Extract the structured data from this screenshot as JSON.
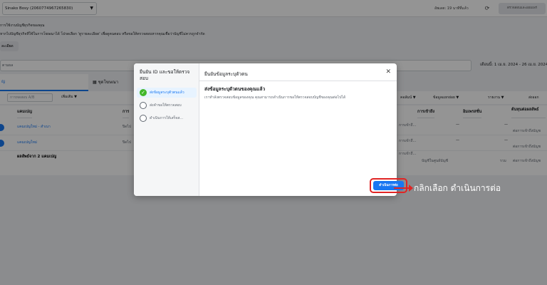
{
  "topbar": {
    "account_select": "Sinako Bosy (2060774967265830)",
    "updated_text": "อัพเดต: 19 นาทีที่แล้ว",
    "review_button": "ตรวจสอบและเผยแพร่"
  },
  "notice": {
    "line1": "การใช้งานบัญชีธุรกิจของคุณ",
    "line2": "หากไปบัญชีธุรกิจที่ใช้ในการโฆษณาได้ โปรดเลือก 'ดูรายละเอียด' เพื่อดูคนตอบ หรือขอให้ตรวจสอบหากคุณเชื่อว่าบัญชีไม่ควรถูกจำกัด",
    "details_button": "ละเอียด"
  },
  "filters": {
    "search_placeholder": "ตามผล",
    "date_range": "เดือนนี้: 1 เม.ย. 2024 - 26 เม.ย. 2024"
  },
  "tabs": {
    "campaigns": "ญ",
    "ads": "ชุดโฆษณา"
  },
  "toolbar": {
    "ab_test": "การทดสอบ A/B",
    "more": "เพิ่มเติม",
    "columns": "คอลัมน์",
    "breakdown": "ข้อมูลแยกย่อย",
    "reports": "รายงาน",
    "export": "ส่งออก"
  },
  "table": {
    "headers": {
      "campaign": "แคมเปญ",
      "delivery": "การ",
      "reach": "การเข้าถึง",
      "impressions": "อิมเพรสชั่น",
      "cost": "ต้นทุนต่อผลลัพธ์"
    },
    "rows": [
      {
        "name": "แคมเปญใหม่ - สำเนา",
        "status": "ปิดไป",
        "c1": "การเข้าถึ...",
        "c2": "—",
        "c3": "—",
        "c4": "ต่อการเข้าถึงบัญช"
      },
      {
        "name": "แคมเปญใหม่",
        "status": "ปิดไป",
        "c1": "การเข้าถึ...",
        "c2": "—",
        "c3": "—",
        "c4": "ต่อการเข้าถึงบัญช"
      }
    ],
    "total": {
      "label": "ผลลัพธ์จาก 2 แคมเปญ",
      "c1": "การเข้าถึ...",
      "c2": "บัญชีในศูนย์บัญชี",
      "c3": "รวม",
      "c4": "ต่อการเข้าถึงบัญช"
    }
  },
  "modal": {
    "left_title": "ยืนยัน ID และขอให้ตรวจสอบ",
    "steps": [
      {
        "label": "ส่งข้อมูลระบุตัวตนแล้ว",
        "done": true
      },
      {
        "label": "ส่งคำขอให้ตรวจสอบ",
        "done": false
      },
      {
        "label": "ดำเนินการให้เสร็จส...",
        "done": false
      }
    ],
    "header": "ยืนยันข้อมูลระบุตัวตน",
    "title": "ส่งข้อมูลระบุตัวตนของคุณแล้ว",
    "description": "เราทำลังตรวจสอบข้อมูลของคุณ คุณสามารถดำเนินการขอให้ตรวจสอบบัญชีของคุณต่อไปได้",
    "continue_button": "ดำเนินการต่อ"
  },
  "callout": {
    "text": "กลิกเลือก ดำเนินการต่อ",
    "color": "#e02424"
  }
}
